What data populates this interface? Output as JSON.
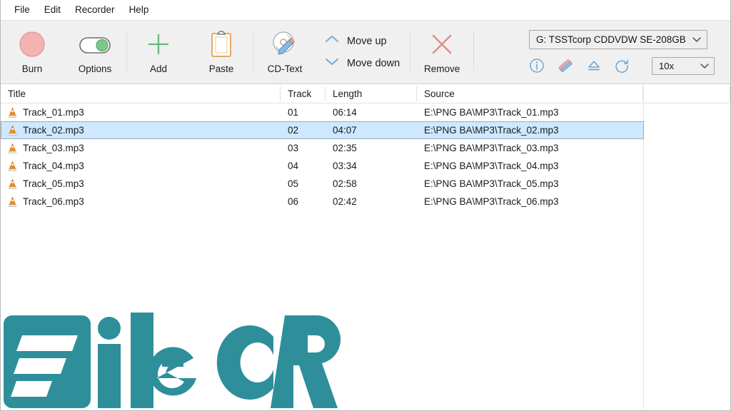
{
  "menubar": {
    "items": [
      {
        "label": "File"
      },
      {
        "label": "Edit"
      },
      {
        "label": "Recorder"
      },
      {
        "label": "Help"
      }
    ]
  },
  "toolbar": {
    "buttons": [
      {
        "label": "Burn",
        "icon": "burn-disc-icon",
        "color": "#f0a8a8"
      },
      {
        "label": "Options",
        "icon": "toggle-switch-icon",
        "color": "#6ec07a"
      },
      {
        "label": "Add",
        "icon": "plus-icon",
        "color": "#61b377"
      },
      {
        "label": "Paste",
        "icon": "clipboard-icon",
        "color": "#e6b366"
      },
      {
        "label": "CD-Text",
        "icon": "cd-pencil-icon",
        "color": "#5b9bd5"
      },
      {
        "label": "Remove",
        "icon": "close-x-icon",
        "color": "#e07b7b"
      }
    ],
    "move_up_label": "Move up",
    "move_down_label": "Move down",
    "move_up_icon": "chevron-up-icon",
    "move_down_icon": "chevron-down-icon",
    "chevron_color": "#7fb3de"
  },
  "recorder": {
    "drive_value": "G: TSSTcorp CDDVDW SE-208GB",
    "drive_caret_icon": "chevron-down-icon",
    "speed_value": "10x",
    "speed_caret_icon": "chevron-down-icon",
    "actions": [
      {
        "icon": "info-circle-icon",
        "color": "#6fa8d4"
      },
      {
        "icon": "eraser-icon",
        "color": "#e89a9a"
      },
      {
        "icon": "eject-icon",
        "color": "#6fa8d4"
      },
      {
        "icon": "refresh-icon",
        "color": "#6fa8d4"
      }
    ]
  },
  "tracklist": {
    "columns": [
      {
        "key": "title",
        "label": "Title"
      },
      {
        "key": "track",
        "label": "Track"
      },
      {
        "key": "length",
        "label": "Length"
      },
      {
        "key": "source",
        "label": "Source"
      },
      {
        "key": "extra",
        "label": ""
      }
    ],
    "row_icon": "vlc-cone-icon",
    "selected_index": 1,
    "rows": [
      {
        "title": "Track_01.mp3",
        "track": "01",
        "length": "06:14",
        "source": "E:\\PNG BA\\MP3\\Track_01.mp3"
      },
      {
        "title": "Track_02.mp3",
        "track": "02",
        "length": "04:07",
        "source": "E:\\PNG BA\\MP3\\Track_02.mp3"
      },
      {
        "title": "Track_03.mp3",
        "track": "03",
        "length": "02:35",
        "source": "E:\\PNG BA\\MP3\\Track_03.mp3"
      },
      {
        "title": "Track_04.mp3",
        "track": "04",
        "length": "03:34",
        "source": "E:\\PNG BA\\MP3\\Track_04.mp3"
      },
      {
        "title": "Track_05.mp3",
        "track": "05",
        "length": "02:58",
        "source": "E:\\PNG BA\\MP3\\Track_05.mp3"
      },
      {
        "title": "Track_06.mp3",
        "track": "06",
        "length": "02:42",
        "source": "E:\\PNG BA\\MP3\\Track_06.mp3"
      }
    ]
  },
  "watermark": {
    "text": "FileCR",
    "color": "#2e8f9b"
  }
}
